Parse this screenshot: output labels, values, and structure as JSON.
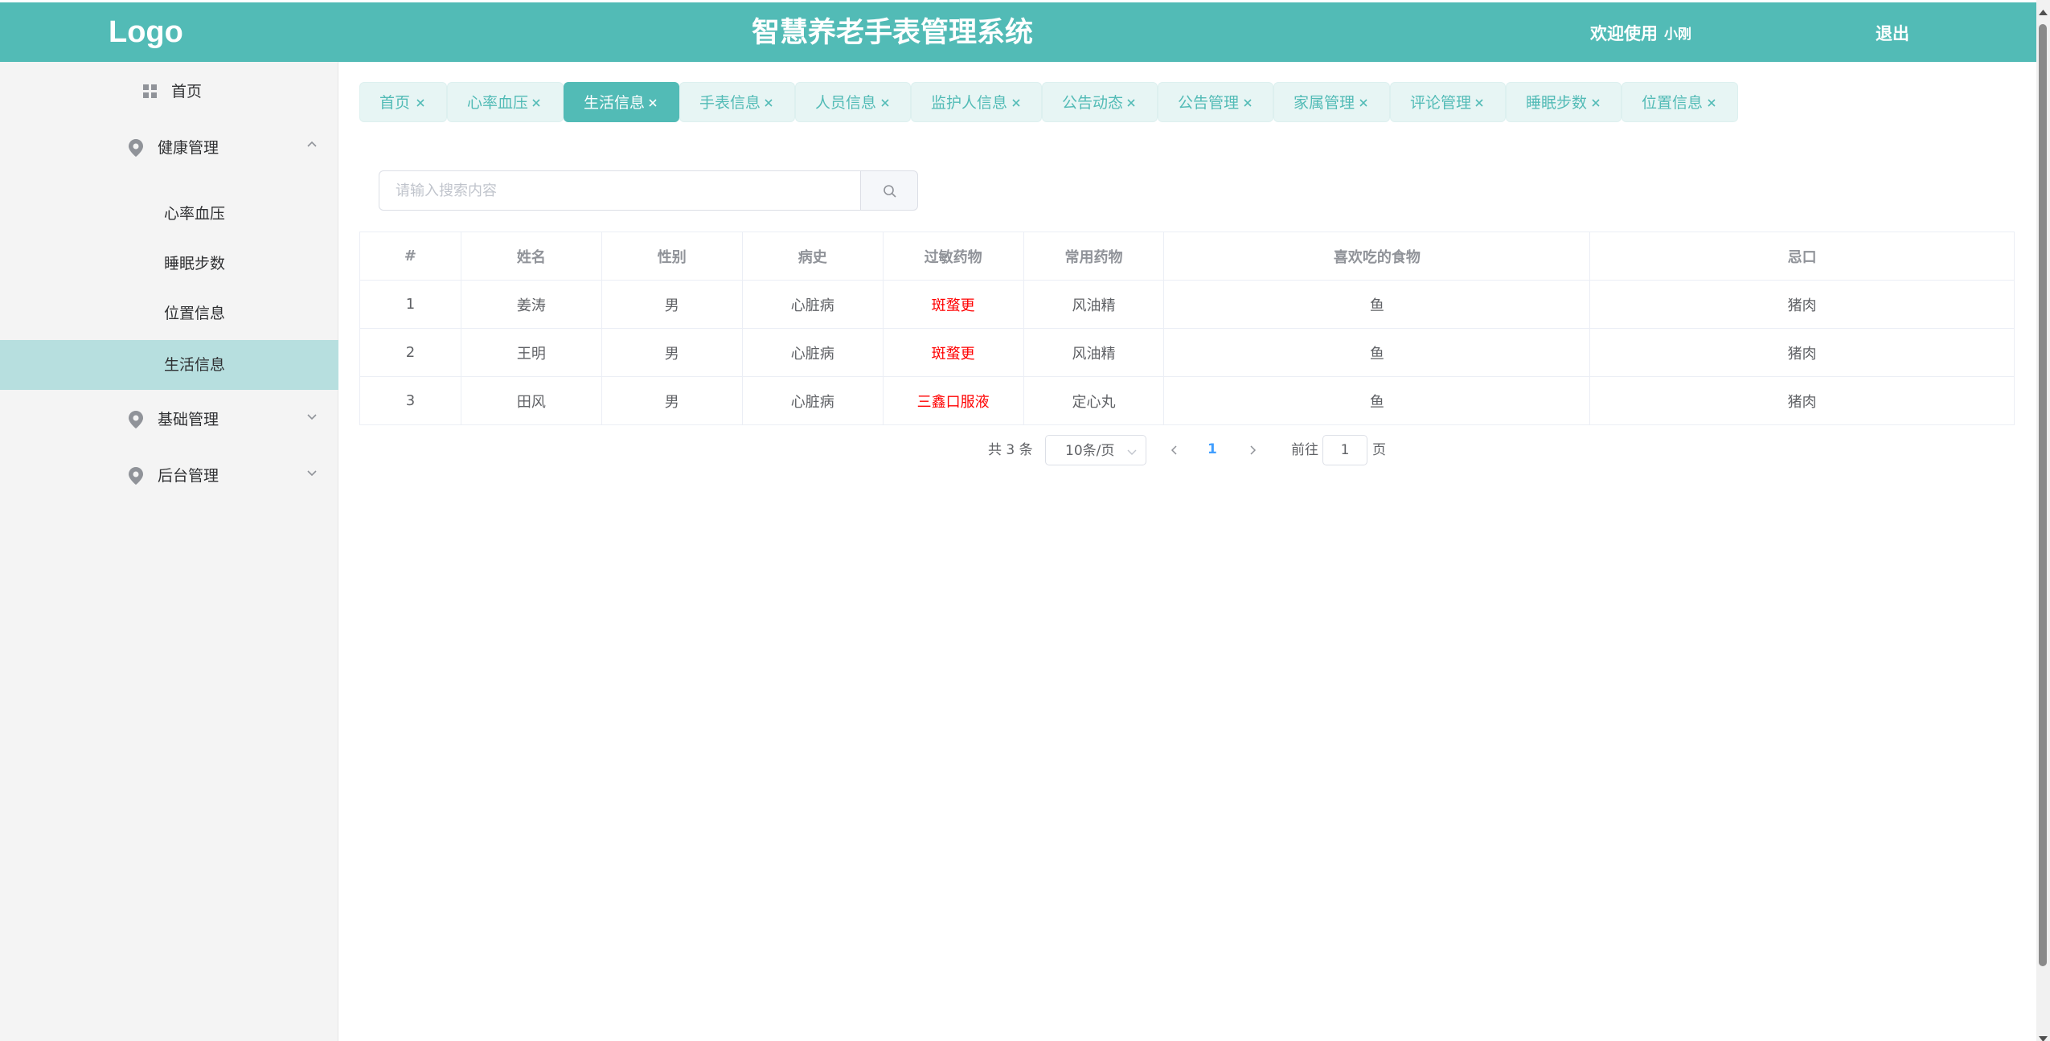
{
  "header": {
    "logo": "Logo",
    "title": "智慧养老手表管理系统",
    "welcome": "欢迎使用",
    "username": "小刚",
    "logout": "退出"
  },
  "sidebar": {
    "home": "首页",
    "health_group": "健康管理",
    "health_items": [
      "心率血压",
      "睡眠步数",
      "位置信息",
      "生活信息"
    ],
    "active_item": "生活信息",
    "basic_group": "基础管理",
    "admin_group": "后台管理"
  },
  "tabs": [
    {
      "label": "首页"
    },
    {
      "label": "心率血压"
    },
    {
      "label": "生活信息"
    },
    {
      "label": "手表信息"
    },
    {
      "label": "人员信息"
    },
    {
      "label": "监护人信息"
    },
    {
      "label": "公告动态"
    },
    {
      "label": "公告管理"
    },
    {
      "label": "家属管理"
    },
    {
      "label": "评论管理"
    },
    {
      "label": "睡眠步数"
    },
    {
      "label": "位置信息"
    }
  ],
  "active_tab": "生活信息",
  "search": {
    "placeholder": "请输入搜索内容",
    "value": ""
  },
  "table": {
    "headers": [
      "#",
      "姓名",
      "性别",
      "病史",
      "过敏药物",
      "常用药物",
      "喜欢吃的食物",
      "忌口"
    ],
    "rows": [
      [
        "1",
        "姜涛",
        "男",
        "心脏病",
        "斑蝥更",
        "风油精",
        "鱼",
        "猪肉"
      ],
      [
        "2",
        "王明",
        "男",
        "心脏病",
        "斑蝥更",
        "风油精",
        "鱼",
        "猪肉"
      ],
      [
        "3",
        "田风",
        "男",
        "心脏病",
        "三鑫口服液",
        "定心丸",
        "鱼",
        "猪肉"
      ]
    ]
  },
  "pagination": {
    "total": "共 3 条",
    "page_size": "10条/页",
    "current_page": "1",
    "goto_label": "前往",
    "goto_value": "1",
    "page_suffix": "页"
  },
  "colors": {
    "brand": "#52bbb6",
    "sidebar_bg": "#f4f4f4",
    "sidebar_active": "#b7dfdf",
    "tab_bg": "#e7f5f4",
    "allergy_text": "#ff0000",
    "pager_active": "#409eff"
  },
  "icons": {
    "home": "grid-icon",
    "groups": "location-pin-icon",
    "tab_close": "close-icon",
    "search": "search-icon"
  }
}
